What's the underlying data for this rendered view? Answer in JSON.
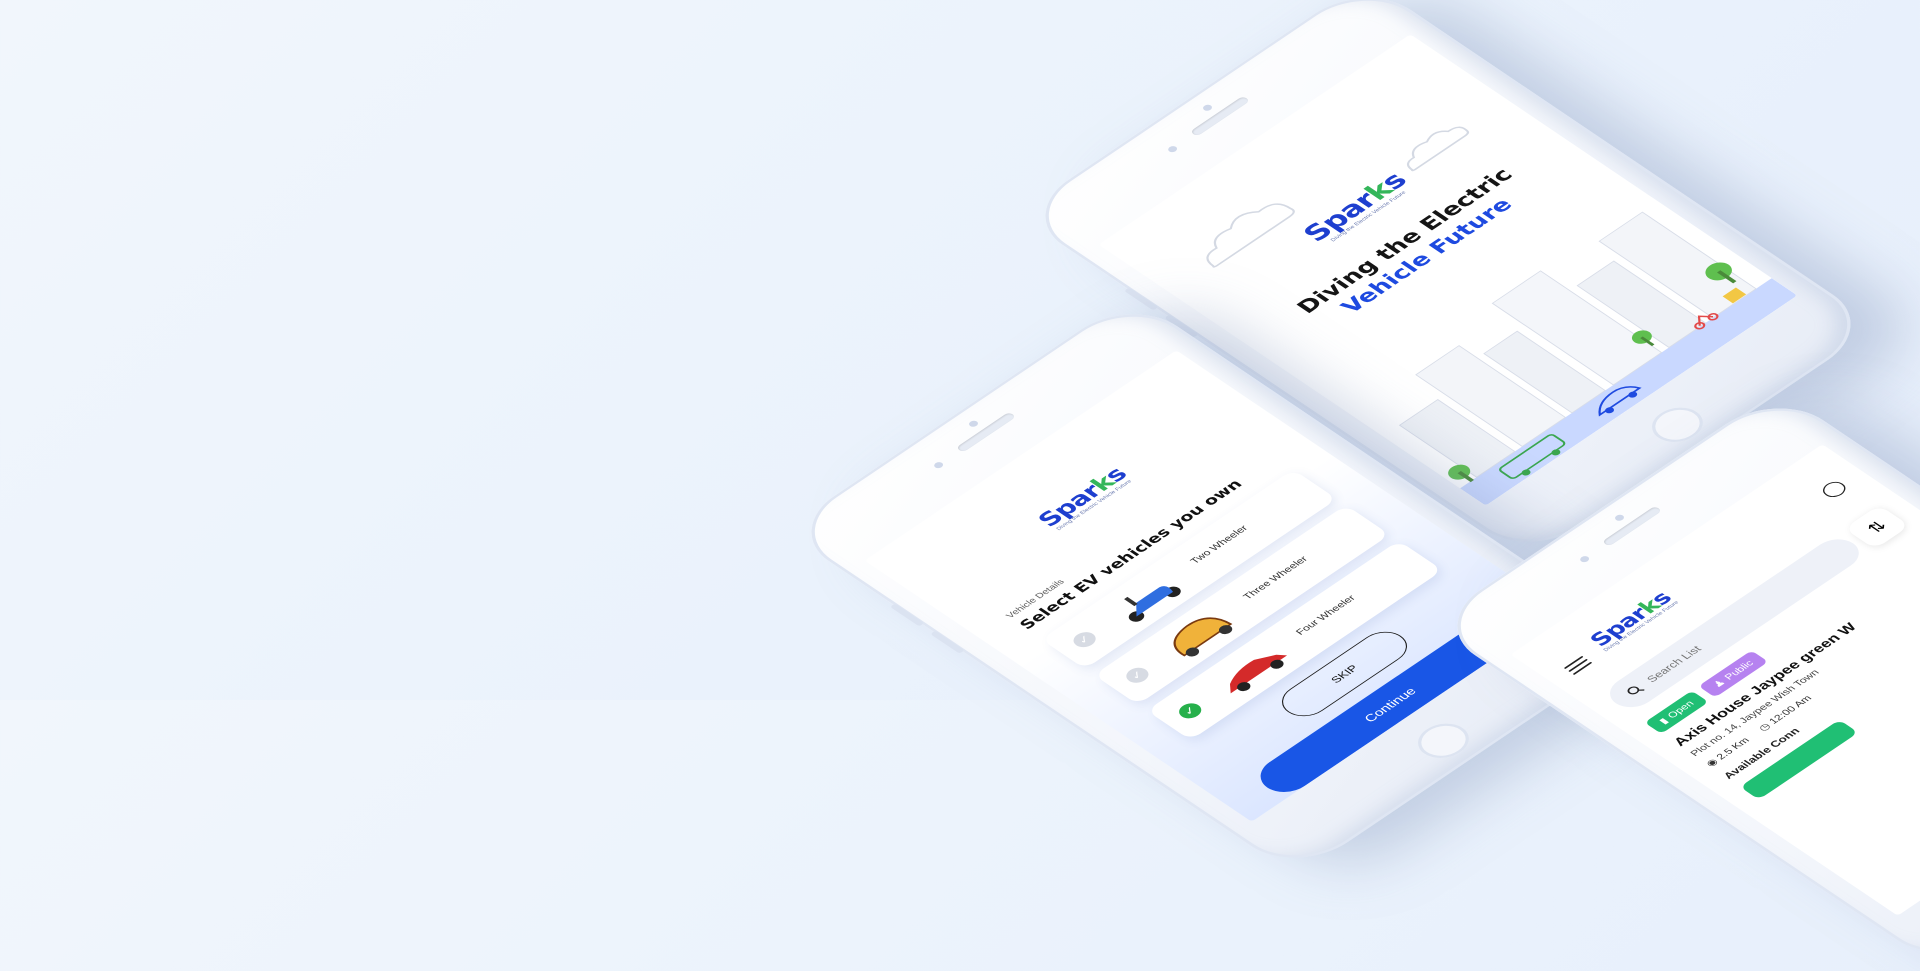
{
  "colors": {
    "background": "#eaf2fc",
    "brand_blue": "#1e3fcf",
    "brand_green": "#34b65a",
    "primary_button": "#1956e6",
    "open_badge": "#20bf74",
    "public_badge": "#b682f0"
  },
  "brand": {
    "logo_text_main": "Spar",
    "logo_text_bolt": "k",
    "logo_text_end": "s",
    "tagline": "Diving the Electric Vehicle Future"
  },
  "splash": {
    "headline_line1": "Diving the Electric",
    "headline_line2": "Vehicle Future"
  },
  "select": {
    "section_label": "Vehicle Details",
    "title": "Select EV vehicles you own",
    "vehicles": [
      {
        "name": "Two Wheeler",
        "selected": false,
        "icon": "scooter-icon"
      },
      {
        "name": "Three Wheeler",
        "selected": false,
        "icon": "auto-rickshaw-icon"
      },
      {
        "name": "Four Wheeler",
        "selected": true,
        "icon": "car-icon"
      }
    ],
    "skip_label": "SKIP",
    "continue_label": "Continue"
  },
  "list": {
    "search_placeholder": "Search List",
    "badge_open": "Open",
    "badge_public": "Public",
    "station_name": "Axis House Jaypee green W",
    "station_address": "Plot no. 14, Jaypee Wish Town",
    "distance": "2.5 Km",
    "time": "12:00 Am",
    "available_label": "Available Conn"
  }
}
